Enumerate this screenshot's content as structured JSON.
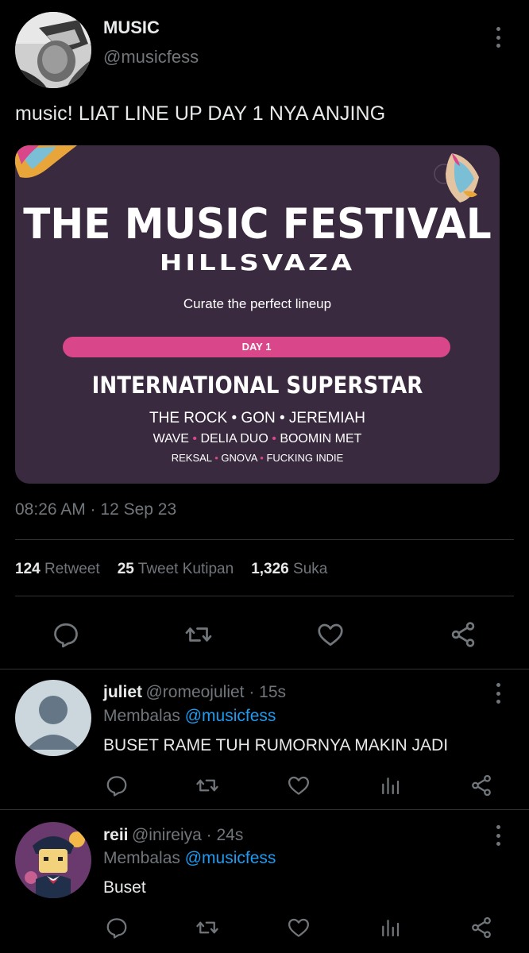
{
  "tweet": {
    "display_name": "MUSIC",
    "handle": "@musicfess",
    "text": "music! LIAT LINE UP DAY 1 NYA ANJING",
    "timestamp": "08:26 AM · 12 Sep 23",
    "stats": [
      {
        "count": "124",
        "label": "Retweet"
      },
      {
        "count": "25",
        "label": "Tweet Kutipan"
      },
      {
        "count": "1,326",
        "label": "Suka"
      }
    ],
    "poster": {
      "title": "THE MUSIC FESTIVAL",
      "subtitle": "HILLSVAZA",
      "tagline": "Curate the perfect lineup",
      "day": "DAY 1",
      "headliner": "INTERNATIONAL SUPERSTAR",
      "row1": "THE ROCK • GON • JEREMIAH",
      "row2": [
        "WAVE",
        "DELIA DUO",
        "BOOMIN MET"
      ],
      "row3": [
        "REKSAL",
        "GNOVA",
        "FUCKING INDIE"
      ],
      "separator": "•",
      "accent": "#d9468a",
      "background": "#3a2a3f"
    }
  },
  "replies": [
    {
      "name": "juliet",
      "handle": "@romeojuliet · 15s",
      "replying_prefix": "Membalas ",
      "replying_to": "@musicfess",
      "text": "BUSET RAME TUH RUMORNYA MAKIN JADI"
    },
    {
      "name": "reii",
      "handle": "@inireiya · 24s",
      "replying_prefix": "Membalas ",
      "replying_to": "@musicfess",
      "text": "Buset"
    }
  ],
  "colors": {
    "background": "#000000",
    "text": "#e7e9ea",
    "muted": "#71767b",
    "link": "#1d9bf0",
    "divider": "#2f3336"
  },
  "icons": [
    "more-icon",
    "reply-icon",
    "retweet-icon",
    "like-icon",
    "share-icon",
    "analytics-icon"
  ]
}
